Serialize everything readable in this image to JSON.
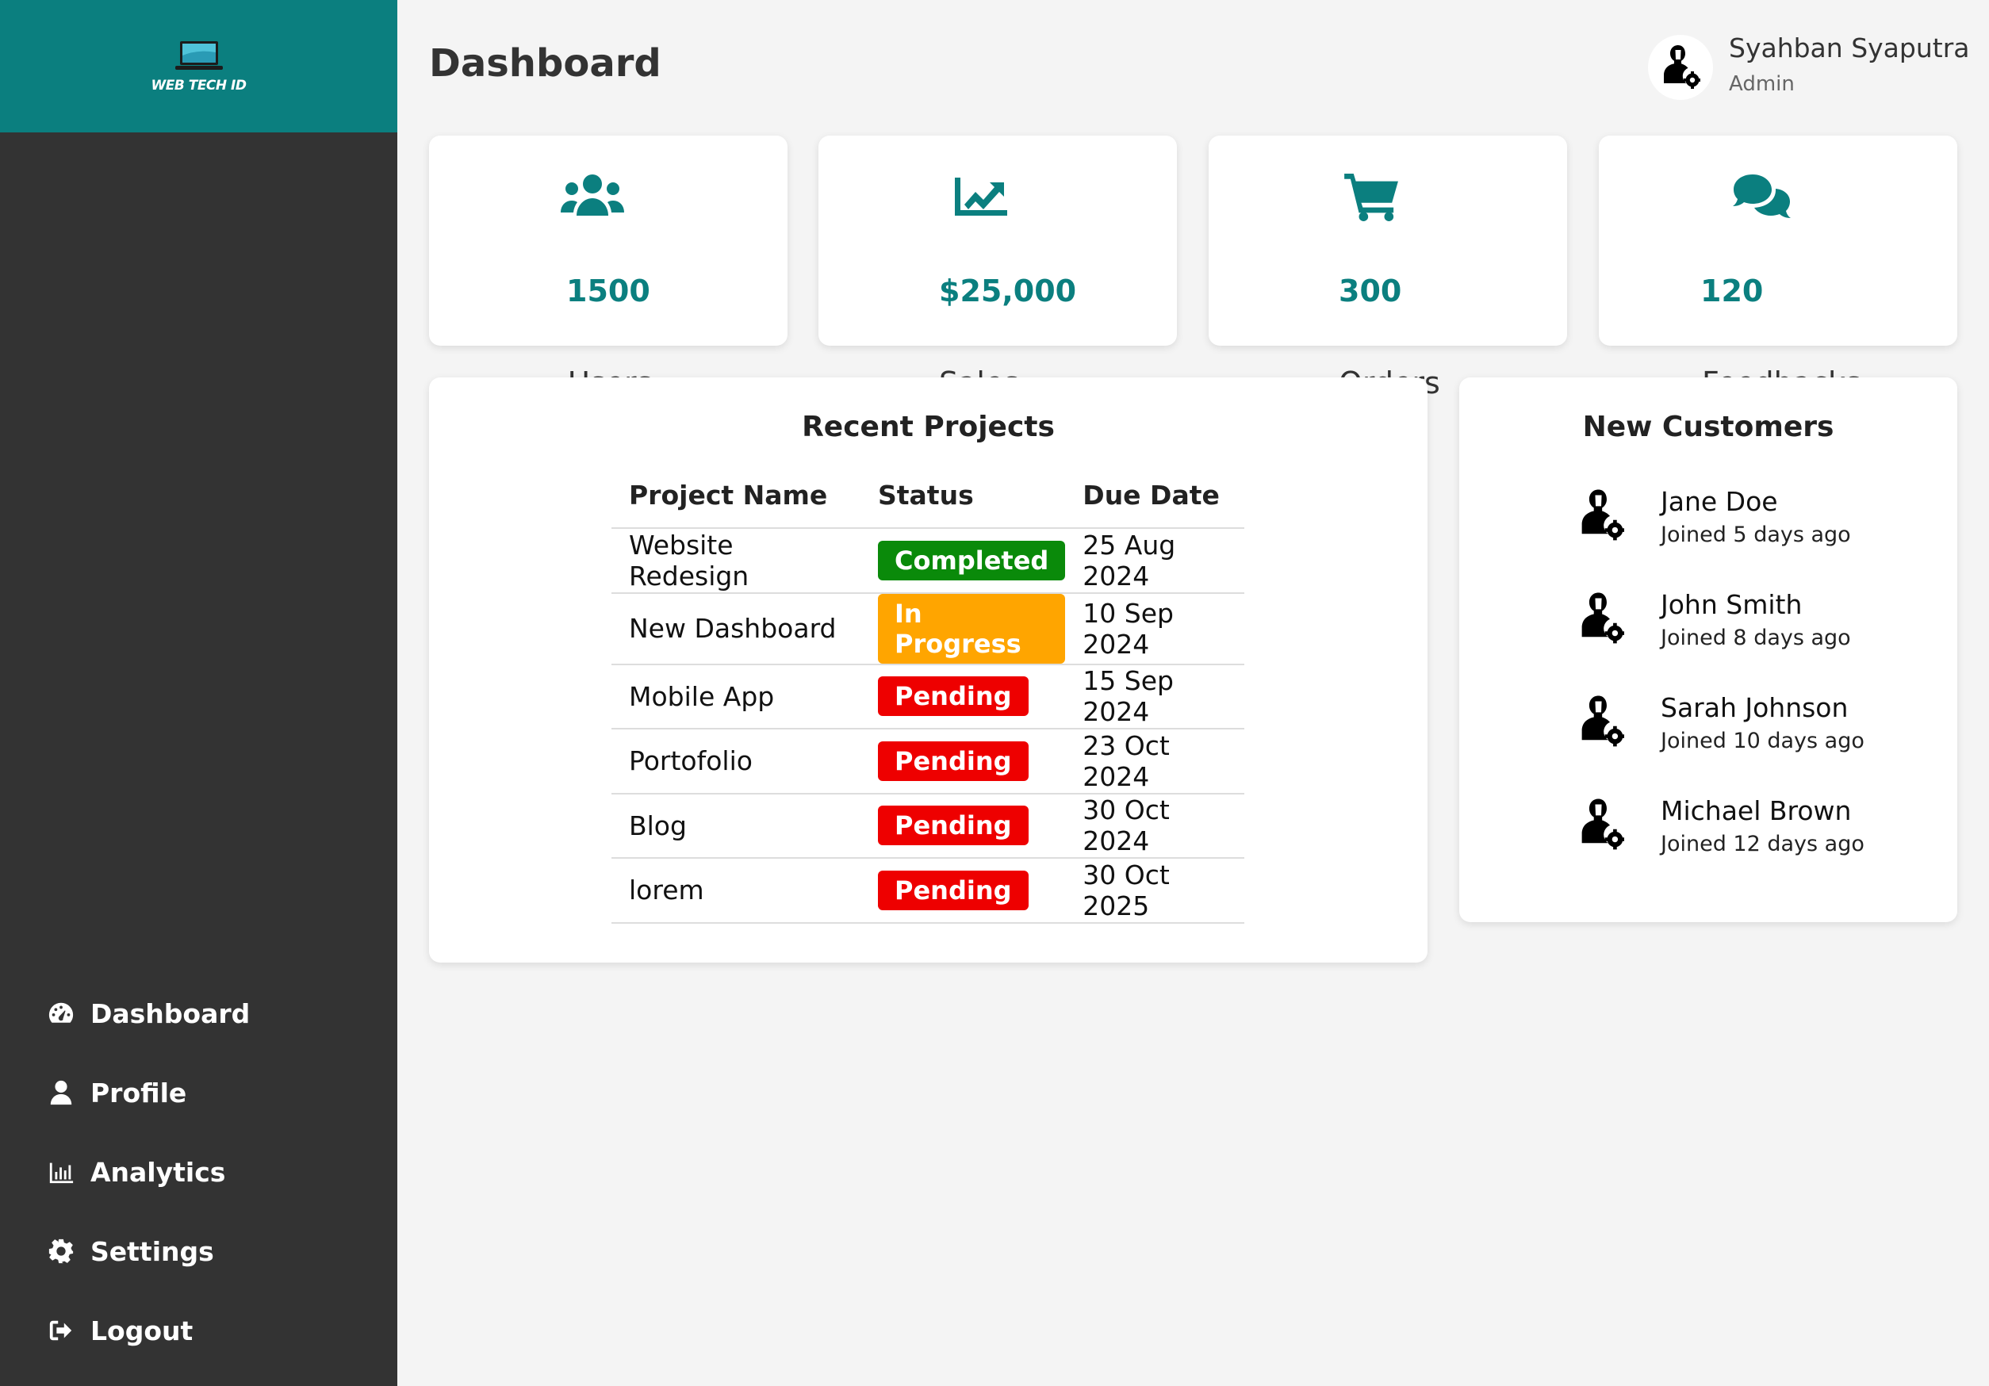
{
  "sidebar": {
    "logo_text": "WEB TECH ID",
    "nav": [
      {
        "label": "Dashboard",
        "icon": "gauge-icon"
      },
      {
        "label": "Profile",
        "icon": "user-icon"
      },
      {
        "label": "Analytics",
        "icon": "bar-chart-icon"
      },
      {
        "label": "Settings",
        "icon": "gear-icon"
      },
      {
        "label": "Logout",
        "icon": "logout-icon"
      }
    ]
  },
  "header": {
    "title": "Dashboard",
    "user_name": "Syahban Syaputra",
    "user_role": "Admin"
  },
  "stats": [
    {
      "label": "Users",
      "value": "1500",
      "icon": "users-icon"
    },
    {
      "label": "Sales",
      "value": "$25,000",
      "icon": "chart-line-icon"
    },
    {
      "label": "Orders",
      "value": "300",
      "icon": "cart-icon"
    },
    {
      "label": "Feedbacks",
      "value": "120",
      "icon": "comments-icon"
    }
  ],
  "projects": {
    "title": "Recent Projects",
    "columns": [
      "Project Name",
      "Status",
      "Due Date"
    ],
    "rows": [
      {
        "name": "Website Redesign",
        "status": "Completed",
        "due": "25 Aug 2024"
      },
      {
        "name": "New Dashboard",
        "status": "In Progress",
        "due": "10 Sep 2024"
      },
      {
        "name": "Mobile App",
        "status": "Pending",
        "due": "15 Sep 2024"
      },
      {
        "name": "Portofolio",
        "status": "Pending",
        "due": "23 Oct 2024"
      },
      {
        "name": "Blog",
        "status": "Pending",
        "due": "30 Oct 2024"
      },
      {
        "name": "lorem",
        "status": "Pending",
        "due": "30 Oct 2025"
      }
    ]
  },
  "customers": {
    "title": "New Customers",
    "items": [
      {
        "name": "Jane Doe",
        "joined": "Joined 5 days ago"
      },
      {
        "name": "John Smith",
        "joined": "Joined 8 days ago"
      },
      {
        "name": "Sarah Johnson",
        "joined": "Joined 10 days ago"
      },
      {
        "name": "Michael Brown",
        "joined": "Joined 12 days ago"
      }
    ]
  },
  "colors": {
    "accent": "#0b7f7f",
    "sidebar_bg": "#333333",
    "completed": "#0a8a0a",
    "in_progress": "#ffa500",
    "pending": "#ee0000"
  }
}
